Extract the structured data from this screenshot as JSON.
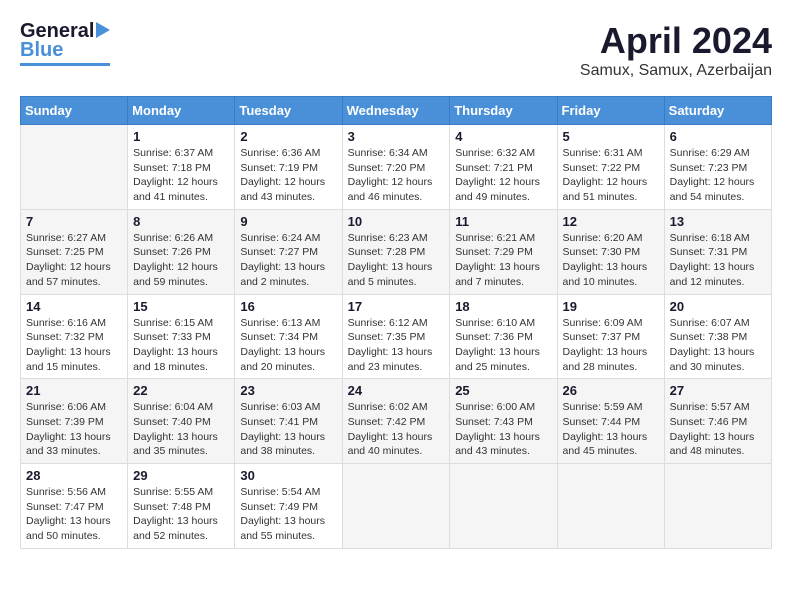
{
  "header": {
    "logo_general": "General",
    "logo_blue": "Blue",
    "title": "April 2024",
    "subtitle": "Samux, Samux, Azerbaijan"
  },
  "weekdays": [
    "Sunday",
    "Monday",
    "Tuesday",
    "Wednesday",
    "Thursday",
    "Friday",
    "Saturday"
  ],
  "weeks": [
    [
      {
        "day": "",
        "sunrise": "",
        "sunset": "",
        "daylight": ""
      },
      {
        "day": "1",
        "sunrise": "Sunrise: 6:37 AM",
        "sunset": "Sunset: 7:18 PM",
        "daylight": "Daylight: 12 hours and 41 minutes."
      },
      {
        "day": "2",
        "sunrise": "Sunrise: 6:36 AM",
        "sunset": "Sunset: 7:19 PM",
        "daylight": "Daylight: 12 hours and 43 minutes."
      },
      {
        "day": "3",
        "sunrise": "Sunrise: 6:34 AM",
        "sunset": "Sunset: 7:20 PM",
        "daylight": "Daylight: 12 hours and 46 minutes."
      },
      {
        "day": "4",
        "sunrise": "Sunrise: 6:32 AM",
        "sunset": "Sunset: 7:21 PM",
        "daylight": "Daylight: 12 hours and 49 minutes."
      },
      {
        "day": "5",
        "sunrise": "Sunrise: 6:31 AM",
        "sunset": "Sunset: 7:22 PM",
        "daylight": "Daylight: 12 hours and 51 minutes."
      },
      {
        "day": "6",
        "sunrise": "Sunrise: 6:29 AM",
        "sunset": "Sunset: 7:23 PM",
        "daylight": "Daylight: 12 hours and 54 minutes."
      }
    ],
    [
      {
        "day": "7",
        "sunrise": "Sunrise: 6:27 AM",
        "sunset": "Sunset: 7:25 PM",
        "daylight": "Daylight: 12 hours and 57 minutes."
      },
      {
        "day": "8",
        "sunrise": "Sunrise: 6:26 AM",
        "sunset": "Sunset: 7:26 PM",
        "daylight": "Daylight: 12 hours and 59 minutes."
      },
      {
        "day": "9",
        "sunrise": "Sunrise: 6:24 AM",
        "sunset": "Sunset: 7:27 PM",
        "daylight": "Daylight: 13 hours and 2 minutes."
      },
      {
        "day": "10",
        "sunrise": "Sunrise: 6:23 AM",
        "sunset": "Sunset: 7:28 PM",
        "daylight": "Daylight: 13 hours and 5 minutes."
      },
      {
        "day": "11",
        "sunrise": "Sunrise: 6:21 AM",
        "sunset": "Sunset: 7:29 PM",
        "daylight": "Daylight: 13 hours and 7 minutes."
      },
      {
        "day": "12",
        "sunrise": "Sunrise: 6:20 AM",
        "sunset": "Sunset: 7:30 PM",
        "daylight": "Daylight: 13 hours and 10 minutes."
      },
      {
        "day": "13",
        "sunrise": "Sunrise: 6:18 AM",
        "sunset": "Sunset: 7:31 PM",
        "daylight": "Daylight: 13 hours and 12 minutes."
      }
    ],
    [
      {
        "day": "14",
        "sunrise": "Sunrise: 6:16 AM",
        "sunset": "Sunset: 7:32 PM",
        "daylight": "Daylight: 13 hours and 15 minutes."
      },
      {
        "day": "15",
        "sunrise": "Sunrise: 6:15 AM",
        "sunset": "Sunset: 7:33 PM",
        "daylight": "Daylight: 13 hours and 18 minutes."
      },
      {
        "day": "16",
        "sunrise": "Sunrise: 6:13 AM",
        "sunset": "Sunset: 7:34 PM",
        "daylight": "Daylight: 13 hours and 20 minutes."
      },
      {
        "day": "17",
        "sunrise": "Sunrise: 6:12 AM",
        "sunset": "Sunset: 7:35 PM",
        "daylight": "Daylight: 13 hours and 23 minutes."
      },
      {
        "day": "18",
        "sunrise": "Sunrise: 6:10 AM",
        "sunset": "Sunset: 7:36 PM",
        "daylight": "Daylight: 13 hours and 25 minutes."
      },
      {
        "day": "19",
        "sunrise": "Sunrise: 6:09 AM",
        "sunset": "Sunset: 7:37 PM",
        "daylight": "Daylight: 13 hours and 28 minutes."
      },
      {
        "day": "20",
        "sunrise": "Sunrise: 6:07 AM",
        "sunset": "Sunset: 7:38 PM",
        "daylight": "Daylight: 13 hours and 30 minutes."
      }
    ],
    [
      {
        "day": "21",
        "sunrise": "Sunrise: 6:06 AM",
        "sunset": "Sunset: 7:39 PM",
        "daylight": "Daylight: 13 hours and 33 minutes."
      },
      {
        "day": "22",
        "sunrise": "Sunrise: 6:04 AM",
        "sunset": "Sunset: 7:40 PM",
        "daylight": "Daylight: 13 hours and 35 minutes."
      },
      {
        "day": "23",
        "sunrise": "Sunrise: 6:03 AM",
        "sunset": "Sunset: 7:41 PM",
        "daylight": "Daylight: 13 hours and 38 minutes."
      },
      {
        "day": "24",
        "sunrise": "Sunrise: 6:02 AM",
        "sunset": "Sunset: 7:42 PM",
        "daylight": "Daylight: 13 hours and 40 minutes."
      },
      {
        "day": "25",
        "sunrise": "Sunrise: 6:00 AM",
        "sunset": "Sunset: 7:43 PM",
        "daylight": "Daylight: 13 hours and 43 minutes."
      },
      {
        "day": "26",
        "sunrise": "Sunrise: 5:59 AM",
        "sunset": "Sunset: 7:44 PM",
        "daylight": "Daylight: 13 hours and 45 minutes."
      },
      {
        "day": "27",
        "sunrise": "Sunrise: 5:57 AM",
        "sunset": "Sunset: 7:46 PM",
        "daylight": "Daylight: 13 hours and 48 minutes."
      }
    ],
    [
      {
        "day": "28",
        "sunrise": "Sunrise: 5:56 AM",
        "sunset": "Sunset: 7:47 PM",
        "daylight": "Daylight: 13 hours and 50 minutes."
      },
      {
        "day": "29",
        "sunrise": "Sunrise: 5:55 AM",
        "sunset": "Sunset: 7:48 PM",
        "daylight": "Daylight: 13 hours and 52 minutes."
      },
      {
        "day": "30",
        "sunrise": "Sunrise: 5:54 AM",
        "sunset": "Sunset: 7:49 PM",
        "daylight": "Daylight: 13 hours and 55 minutes."
      },
      {
        "day": "",
        "sunrise": "",
        "sunset": "",
        "daylight": ""
      },
      {
        "day": "",
        "sunrise": "",
        "sunset": "",
        "daylight": ""
      },
      {
        "day": "",
        "sunrise": "",
        "sunset": "",
        "daylight": ""
      },
      {
        "day": "",
        "sunrise": "",
        "sunset": "",
        "daylight": ""
      }
    ]
  ]
}
